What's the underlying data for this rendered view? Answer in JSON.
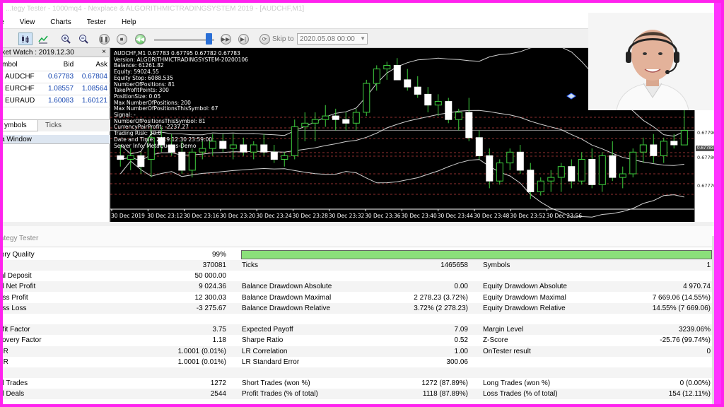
{
  "window": {
    "title": "...tegy Tester - 1000mq4 - Nexplace & ALGORITHMICTRADINGSYSTEM 2019 - [AUDCHF,M1]"
  },
  "menu": [
    "le",
    "View",
    "Charts",
    "Tester",
    "Help"
  ],
  "toolbar": {
    "icons": [
      "candles-icon",
      "line-chart-icon",
      "zoom-in-icon",
      "zoom-out-icon",
      "pause-icon",
      "stop-icon",
      "play-icon",
      "slider",
      "step-icon",
      "skip-end-icon"
    ],
    "skip_to_label": "Skip to",
    "skip_to_date": "2020.05.08 00:00"
  },
  "market_watch": {
    "title": "rket Watch : 2019.12.30",
    "columns": [
      "mbol",
      "Bid",
      "Ask"
    ],
    "rows": [
      {
        "symbol": "AUDCHF",
        "bid": "0.67783",
        "ask": "0.67804"
      },
      {
        "symbol": "EURCHF",
        "bid": "1.08557",
        "ask": "1.08564"
      },
      {
        "symbol": "EURAUD",
        "bid": "1.60083",
        "ask": "1.60121"
      }
    ],
    "tabs": [
      "ymbols",
      "Ticks"
    ],
    "data_window_title": "a Window"
  },
  "chart": {
    "info_lines": [
      "AUDCHF,M1  0.67783 0.67795 0.67782 0.67783",
      "Version: ALGORITHMICTRADINGSYSTEM-20200106",
      "Balance: 61261.82",
      "Equity: 59024.55",
      "Equity Stop: 6088.535",
      "NumberOfPositions: 81",
      "TakeProfitPoints: 300",
      "PositionSize: 0.05",
      "Max NumberOfPositions: 200",
      "Max NumberOfPositionsThisSymbol: 67",
      "Signal: -",
      "NumberOfPositionsThisSymbol: 81",
      "CurrencyPairProfit: -2237.27",
      "Trading Risk: 30.0",
      "Date and Time: 2019.12.30 23:59:00",
      "Server Info: MetaQuotes-Demo"
    ],
    "time_labels": [
      "30 Dec 2019",
      "30 Dec 23:12",
      "30 Dec 23:16",
      "30 Dec 23:20",
      "30 Dec 23:24",
      "30 Dec 23:28",
      "30 Dec 23:32",
      "30 Dec 23:36",
      "30 Dec 23:40",
      "30 Dec 23:44",
      "30 Dec 23:48",
      "30 Dec 23:52",
      "30 Dec 23:56"
    ],
    "price_labels": [
      "0.67790",
      "0.67780",
      "0.67770"
    ],
    "current_price": "0.67783",
    "candles_o_h_l_c": [
      [
        0.67776,
        0.67779,
        0.67773,
        0.67775
      ],
      [
        0.67775,
        0.67778,
        0.67772,
        0.67776
      ],
      [
        0.67776,
        0.67777,
        0.67771,
        0.67773
      ],
      [
        0.67775,
        0.67784,
        0.6777,
        0.67781
      ],
      [
        0.67781,
        0.67784,
        0.67777,
        0.67779
      ],
      [
        0.67779,
        0.67782,
        0.67776,
        0.67777
      ],
      [
        0.67777,
        0.6778,
        0.67771,
        0.67772
      ],
      [
        0.67772,
        0.67778,
        0.6777,
        0.67777
      ],
      [
        0.67777,
        0.6778,
        0.67775,
        0.67778
      ],
      [
        0.67778,
        0.67782,
        0.67776,
        0.6778
      ],
      [
        0.6778,
        0.67782,
        0.67777,
        0.67778
      ],
      [
        0.67778,
        0.67782,
        0.67775,
        0.67779
      ],
      [
        0.67779,
        0.67781,
        0.67776,
        0.67777
      ],
      [
        0.67777,
        0.6778,
        0.67775,
        0.67779
      ],
      [
        0.67779,
        0.67782,
        0.67776,
        0.67777
      ],
      [
        0.67777,
        0.67779,
        0.67774,
        0.67775
      ],
      [
        0.67775,
        0.67777,
        0.67773,
        0.67776
      ],
      [
        0.67776,
        0.67786,
        0.67775,
        0.67784
      ],
      [
        0.67784,
        0.67788,
        0.6778,
        0.67785
      ],
      [
        0.67785,
        0.67788,
        0.6778,
        0.67786
      ],
      [
        0.67786,
        0.6779,
        0.67784,
        0.67787
      ],
      [
        0.67787,
        0.67789,
        0.67783,
        0.67786
      ],
      [
        0.67786,
        0.67788,
        0.67783,
        0.67785
      ],
      [
        0.67785,
        0.67789,
        0.67783,
        0.67788
      ],
      [
        0.67788,
        0.67797,
        0.67787,
        0.67796
      ],
      [
        0.67796,
        0.67801,
        0.67794,
        0.678
      ],
      [
        0.678,
        0.67802,
        0.67797,
        0.67801
      ],
      [
        0.67801,
        0.67803,
        0.67797,
        0.67797
      ],
      [
        0.67797,
        0.678,
        0.67794,
        0.67795
      ],
      [
        0.67795,
        0.67798,
        0.67792,
        0.67793
      ],
      [
        0.67793,
        0.67795,
        0.67788,
        0.6779
      ],
      [
        0.6779,
        0.67793,
        0.67787,
        0.67791
      ],
      [
        0.67791,
        0.67792,
        0.67785,
        0.67786
      ],
      [
        0.67786,
        0.67789,
        0.67783,
        0.67788
      ],
      [
        0.67788,
        0.67792,
        0.6778,
        0.67781
      ],
      [
        0.67781,
        0.67783,
        0.67775,
        0.67776
      ],
      [
        0.67776,
        0.67778,
        0.67767,
        0.67769
      ],
      [
        0.67769,
        0.67775,
        0.67768,
        0.67774
      ],
      [
        0.67774,
        0.67778,
        0.67772,
        0.67777
      ],
      [
        0.67777,
        0.67779,
        0.67771,
        0.67772
      ],
      [
        0.67772,
        0.67774,
        0.67764,
        0.67766
      ],
      [
        0.67766,
        0.6777,
        0.67765,
        0.67769
      ],
      [
        0.67769,
        0.67772,
        0.67766,
        0.6777
      ],
      [
        0.6777,
        0.67774,
        0.67766,
        0.67773
      ],
      [
        0.67773,
        0.67775,
        0.67767,
        0.67769
      ],
      [
        0.67769,
        0.67777,
        0.67768,
        0.67775
      ],
      [
        0.67775,
        0.67778,
        0.67767,
        0.67768
      ],
      [
        0.67768,
        0.67777,
        0.67766,
        0.67776
      ],
      [
        0.67776,
        0.6778,
        0.67769,
        0.6777
      ],
      [
        0.6777,
        0.67773,
        0.67767,
        0.67771
      ],
      [
        0.67771,
        0.67778,
        0.6777,
        0.67777
      ],
      [
        0.67777,
        0.67781,
        0.67774,
        0.67779
      ],
      [
        0.67779,
        0.67782,
        0.67774,
        0.67776
      ],
      [
        0.67776,
        0.67781,
        0.67774,
        0.6778
      ],
      [
        0.6778,
        0.67782,
        0.67778,
        0.67779
      ],
      [
        0.67779,
        0.67793,
        0.67779,
        0.67783
      ]
    ]
  },
  "tester": {
    "title": "ategy Tester",
    "quality_label": "tory Quality",
    "quality_value": "99%",
    "quality_fraction": 0.99,
    "rows": [
      {
        "l1": "s",
        "v1": "370081",
        "l2": "Ticks",
        "v2": "1465658",
        "l3": "Symbols",
        "v3": "1"
      },
      {
        "l1": "ial Deposit",
        "v1": "50 000.00",
        "l2": "",
        "v2": "",
        "l3": "",
        "v3": ""
      },
      {
        "l1": "al Net Profit",
        "v1": "9 024.36",
        "l2": "Balance Drawdown Absolute",
        "v2": "0.00",
        "l3": "Equity Drawdown Absolute",
        "v3": "4 970.74"
      },
      {
        "l1": "oss Profit",
        "v1": "12 300.03",
        "l2": "Balance Drawdown Maximal",
        "v2": "2 278.23 (3.72%)",
        "l3": "Equity Drawdown Maximal",
        "v3": "7 669.06 (14.55%)"
      },
      {
        "l1": "oss Loss",
        "v1": "-3 275.67",
        "l2": "Balance Drawdown Relative",
        "v2": "3.72% (2 278.23)",
        "l3": "Equity Drawdown Relative",
        "v3": "14.55% (7 669.06)"
      },
      {
        "l1": "",
        "v1": "",
        "l2": "",
        "v2": "",
        "l3": "",
        "v3": ""
      },
      {
        "l1": "ofit Factor",
        "v1": "3.75",
        "l2": "Expected Payoff",
        "v2": "7.09",
        "l3": "Margin Level",
        "v3": "3239.06%"
      },
      {
        "l1": "covery Factor",
        "v1": "1.18",
        "l2": "Sharpe Ratio",
        "v2": "0.52",
        "l3": "Z-Score",
        "v3": "-25.76 (99.74%)"
      },
      {
        "l1": "PR",
        "v1": "1.0001 (0.01%)",
        "l2": "LR Correlation",
        "v2": "1.00",
        "l3": "OnTester result",
        "v3": "0"
      },
      {
        "l1": "PR",
        "v1": "1.0001 (0.01%)",
        "l2": "LR Standard Error",
        "v2": "300.06",
        "l3": "",
        "v3": ""
      },
      {
        "l1": "",
        "v1": "",
        "l2": "",
        "v2": "",
        "l3": "",
        "v3": ""
      },
      {
        "l1": "al Trades",
        "v1": "1272",
        "l2": "Short Trades (won %)",
        "v2": "1272 (87.89%)",
        "l3": "Long Trades (won %)",
        "v3": "0 (0.00%)"
      },
      {
        "l1": "al Deals",
        "v1": "2544",
        "l2": "Profit Trades (% of total)",
        "v2": "1118 (87.89%)",
        "l3": "Loss Trades (% of total)",
        "v3": "154 (12.11%)"
      }
    ]
  },
  "colors": {
    "frame": "#ff22ee",
    "chart_bg": "#000000",
    "quality_bar": "#8be07a",
    "bid_ask": "#1646b0",
    "level_lines": "#c04040"
  }
}
